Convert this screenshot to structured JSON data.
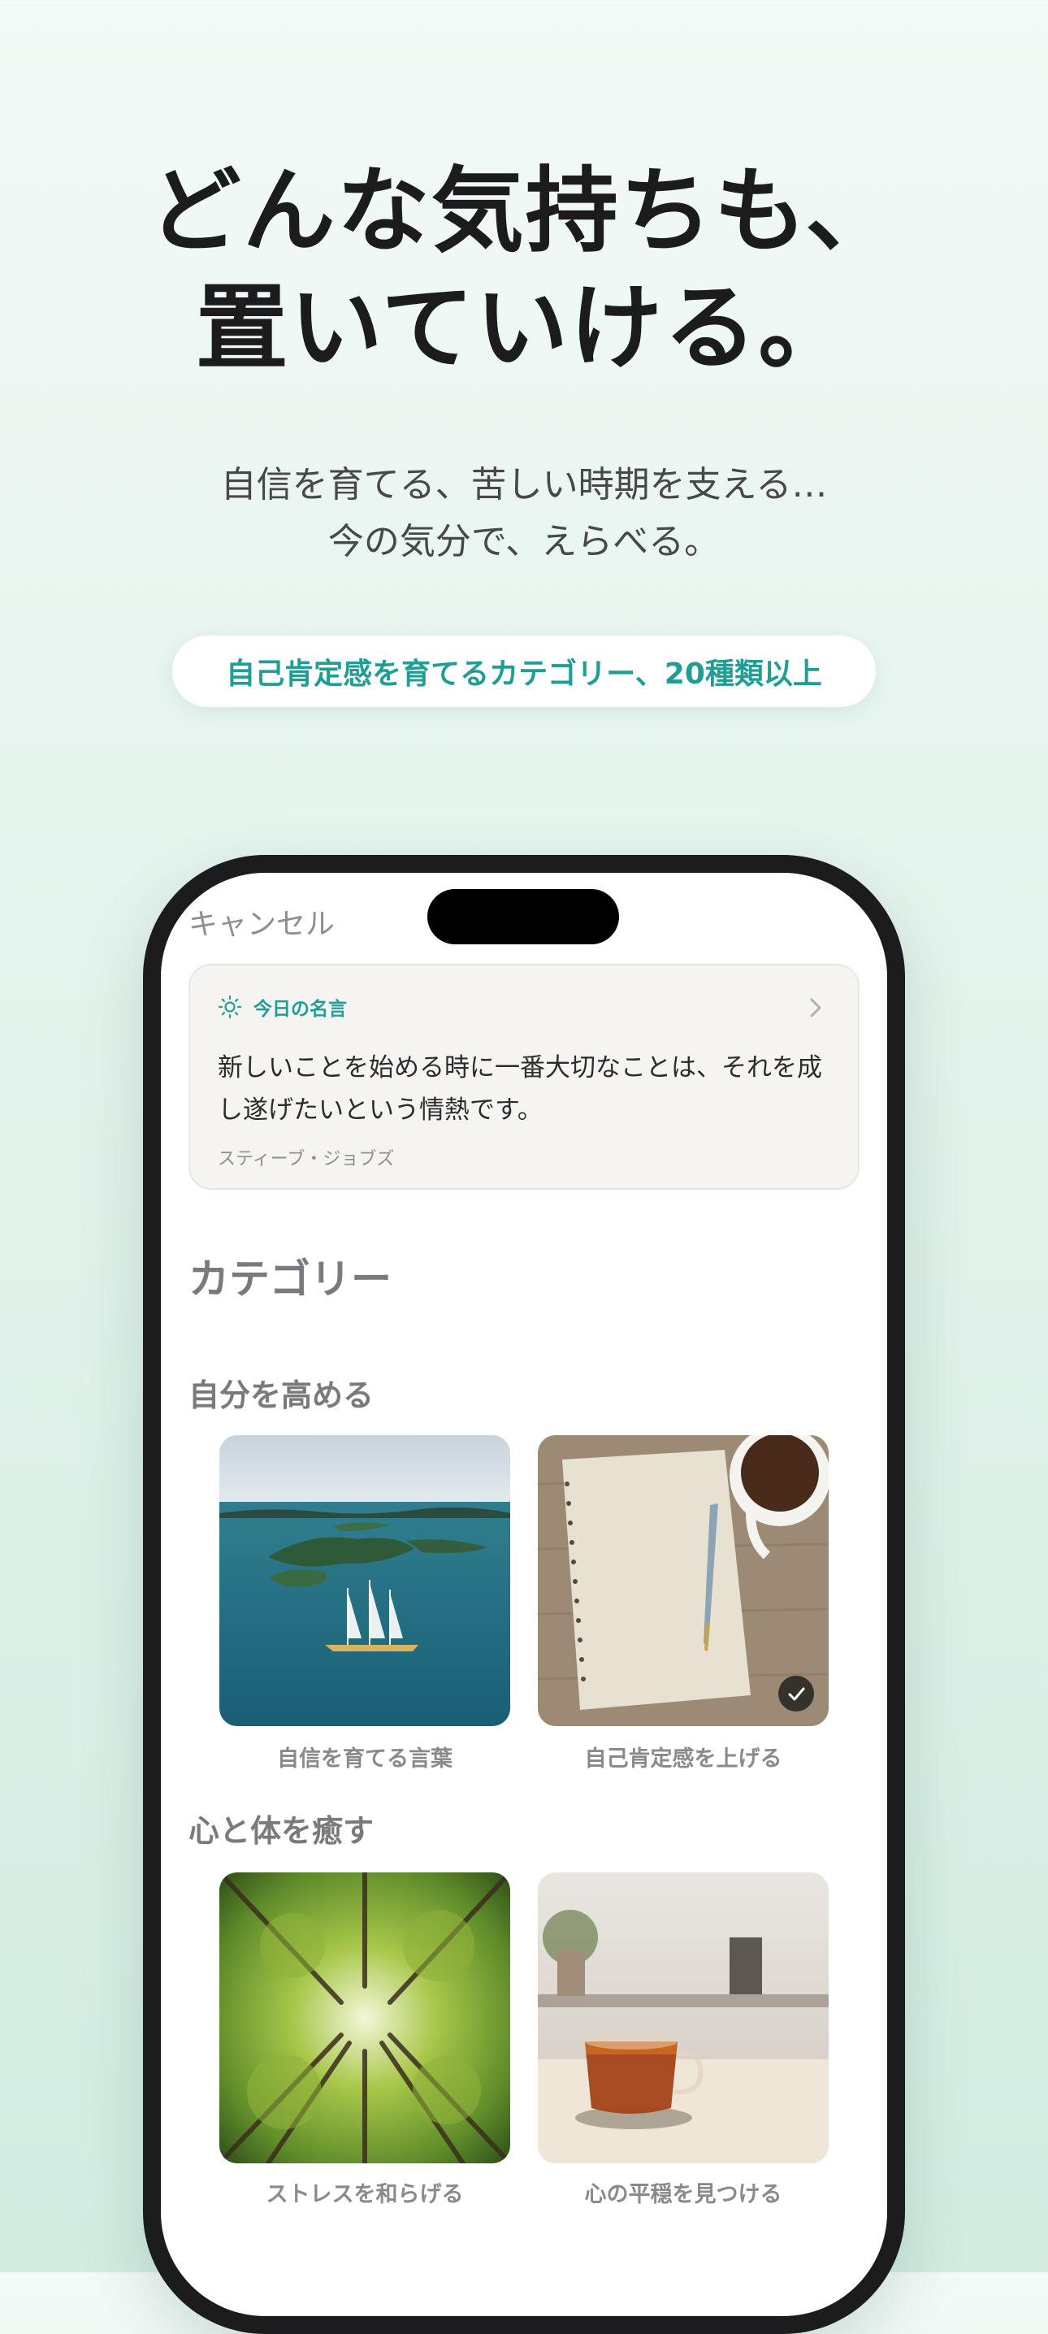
{
  "hero": {
    "headline_line1": "どんな気持ちも、",
    "headline_line2": "置いていける。",
    "subtitle_line1": "自信を育てる、苦しい時期を支える…",
    "subtitle_line2": "今の気分で、えらべる。",
    "pill_label": "自己肯定感を育てるカテゴリー、20種類以上"
  },
  "app": {
    "cancel_label": "キャンセル",
    "quote_card": {
      "icon": "sun-icon",
      "title": "今日の名言",
      "text": "新しいことを始める時に一番大切なことは、それを成し遂げたいという情熱です。",
      "author": "スティーブ・ジョブズ",
      "chevron_icon": "chevron-right-icon"
    },
    "categories_heading": "カテゴリー",
    "sections": [
      {
        "title": "自分を高める",
        "items": [
          {
            "label": "自信を育てる言葉",
            "selected": false
          },
          {
            "label": "自己肯定感を上げる",
            "selected": true
          }
        ]
      },
      {
        "title": "心と体を癒す",
        "items": [
          {
            "label": "ストレスを和らげる",
            "selected": false
          },
          {
            "label": "心の平穏を見つける",
            "selected": false
          }
        ]
      }
    ]
  },
  "colors": {
    "accent_teal": "#1f9e96",
    "headline": "#1c1c1e",
    "phone_frame": "#1c1c1e"
  }
}
